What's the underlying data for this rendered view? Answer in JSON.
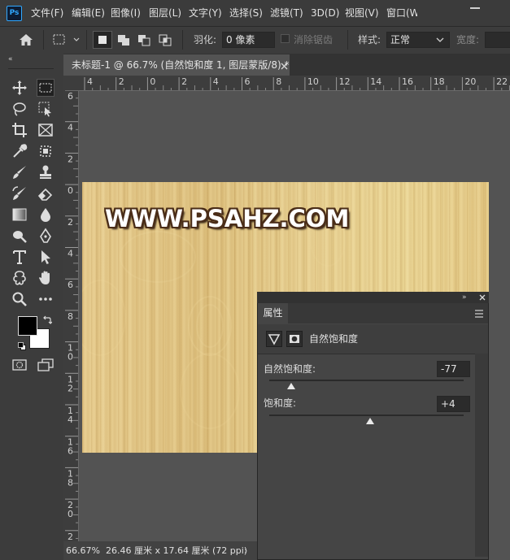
{
  "app": {
    "logo": "Ps"
  },
  "menubar": {
    "items": [
      "文件(F)",
      "编辑(E)",
      "图像(I)",
      "图层(L)",
      "文字(Y)",
      "选择(S)",
      "滤镜(T)",
      "3D(D)",
      "视图(V)",
      "窗口(W"
    ]
  },
  "options": {
    "feather_label": "羽化:",
    "feather_value": "0 像素",
    "antialias_label": "消除锯齿",
    "style_label": "样式:",
    "style_value": "正常",
    "width_label": "宽度:"
  },
  "document": {
    "tab_title": "未标题-1 @ 66.7% (自然饱和度 1, 图层蒙版/8) *"
  },
  "ruler": {
    "h_ticks": [
      "4",
      "2",
      "0",
      "2",
      "4",
      "6",
      "8",
      "10",
      "12",
      "14",
      "16",
      "18",
      "20",
      "22",
      "24",
      "26"
    ],
    "v_labels": [
      "6",
      "4",
      "2",
      "0",
      "2",
      "4",
      "6",
      "8",
      "10",
      "12",
      "14",
      "16",
      "18",
      "20",
      "22"
    ]
  },
  "canvas": {
    "watermark": "WWW.PSAHZ.COM"
  },
  "properties": {
    "tab_label": "属性",
    "title": "自然饱和度",
    "vibrance_label": "自然饱和度:",
    "vibrance_value": "-77",
    "vibrance_level": -77,
    "saturation_label": "饱和度:",
    "saturation_value": "+4",
    "saturation_level": 4
  },
  "status": {
    "zoom": "66.67%",
    "info": "26.46 厘米 x 17.64 厘米 (72 ppi)"
  },
  "colors": {
    "foreground": "#000000",
    "background": "#ffffff",
    "accent": "#31a8ff"
  }
}
